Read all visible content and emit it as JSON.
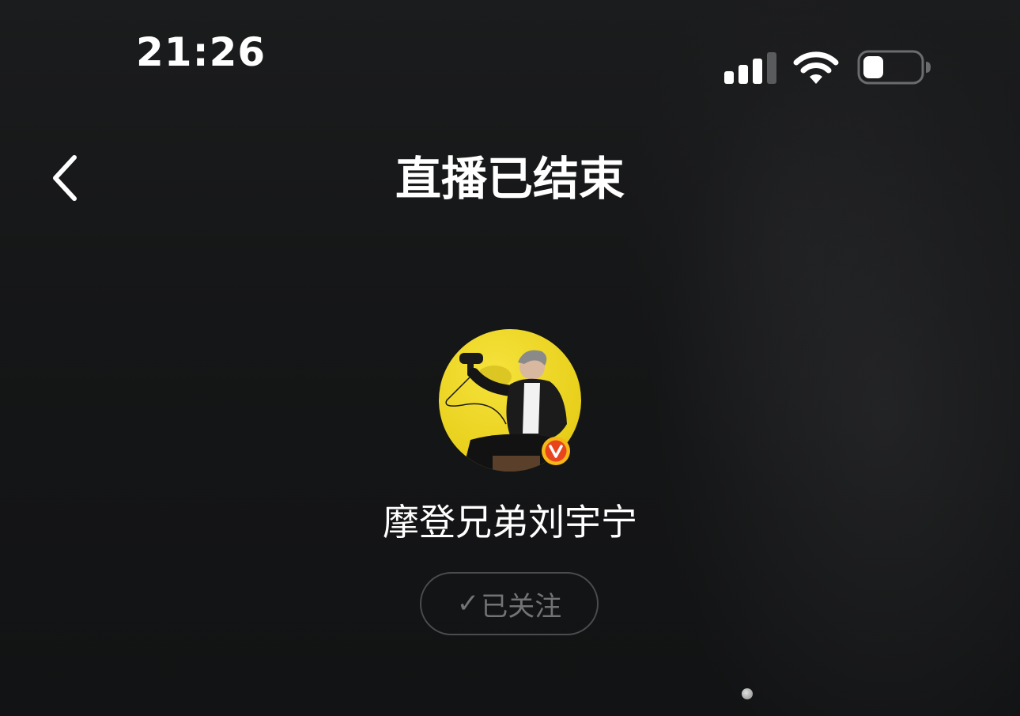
{
  "status_bar": {
    "time": "21:26",
    "signal_icon": "cellular-signal-icon",
    "wifi_icon": "wifi-icon",
    "battery_icon": "battery-icon",
    "battery_level": 0.35
  },
  "nav": {
    "back_icon": "chevron-left-icon",
    "title": "直播已结束"
  },
  "profile": {
    "avatar_icon": "user-avatar",
    "verified_badge_icon": "verified-v-badge-icon",
    "name": "摩登兄弟刘宇宁",
    "follow_button": {
      "check_icon": "checkmark-icon",
      "check_glyph": "✓",
      "label": "已关注"
    }
  },
  "colors": {
    "background": "#151617",
    "text_primary": "#ffffff",
    "text_muted": "#727375",
    "avatar_bg": "#e8cf1b",
    "badge_red": "#e8451e",
    "badge_gold": "#f7b716"
  }
}
